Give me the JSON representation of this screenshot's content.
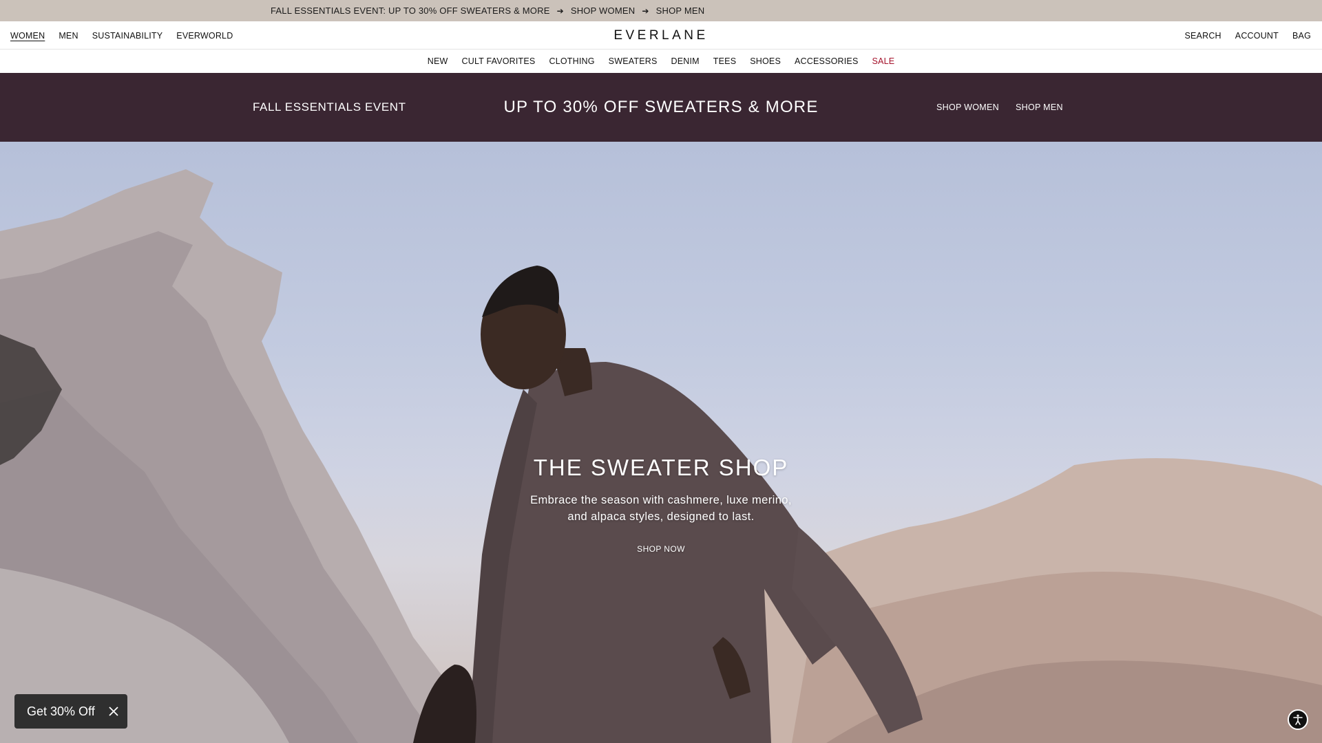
{
  "announcement": {
    "text": "FALL ESSENTIALS EVENT: UP TO 30% OFF SWEATERS & MORE",
    "link_women": "SHOP WOMEN",
    "link_men": "SHOP MEN",
    "arrow": "➔"
  },
  "header": {
    "left_nav": [
      "WOMEN",
      "MEN",
      "SUSTAINABILITY",
      "EVERWORLD"
    ],
    "logo": "EVERLANE",
    "right_nav": [
      "SEARCH",
      "ACCOUNT",
      "BAG"
    ]
  },
  "category_nav": [
    "NEW",
    "CULT FAVORITES",
    "CLOTHING",
    "SWEATERS",
    "DENIM",
    "TEES",
    "SHOES",
    "ACCESSORIES",
    "SALE"
  ],
  "promo": {
    "left": "FALL ESSENTIALS EVENT",
    "center": "UP TO 30% OFF SWEATERS & MORE",
    "shop_women": "SHOP WOMEN",
    "shop_men": "SHOP MEN"
  },
  "hero": {
    "title": "THE SWEATER SHOP",
    "subtitle_line1": "Embrace the season with cashmere, luxe merino,",
    "subtitle_line2": "and alpaca styles, designed to last.",
    "cta": "SHOP NOW"
  },
  "offer": {
    "label": "Get 30% Off"
  },
  "colors": {
    "announcement_bg": "#cbc2ba",
    "promo_bg": "#3a2632",
    "sale": "#a4122b",
    "offer_bg": "#2f2f2f"
  }
}
